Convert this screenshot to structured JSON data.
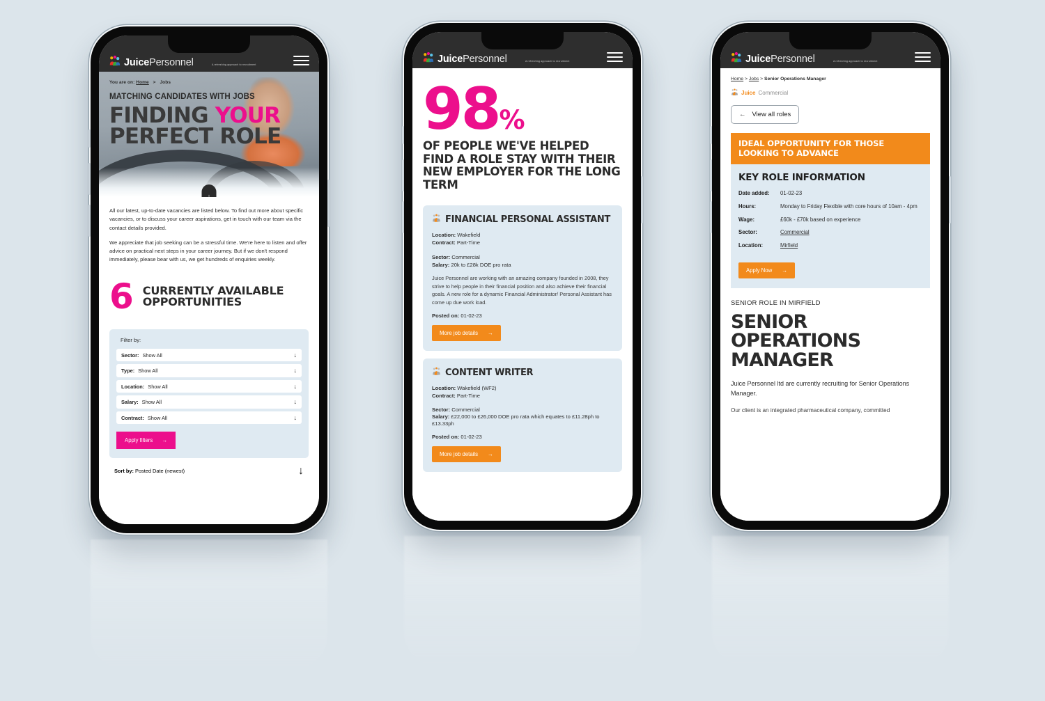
{
  "brand": {
    "name_bold": "Juice",
    "name_light": "Personnel",
    "tagline": "A refreshing approach to recruitment",
    "logo_icon": "people-logo-icon",
    "menu_icon": "hamburger-menu-icon"
  },
  "colors": {
    "background": "#dce5eb",
    "header": "#2e2e2e",
    "pink": "#ec0f8c",
    "orange": "#f28a1b",
    "card": "#dfeaf2",
    "text": "#2b2b2b"
  },
  "phone1": {
    "breadcrumb": {
      "prefix": "You are on:",
      "home": "Home",
      "separator": ">",
      "current": "Jobs"
    },
    "hero": {
      "kicker": "MATCHING CANDIDATES WITH JOBS",
      "title_line1_a": "FINDING ",
      "title_line1_b": "YOUR",
      "title_line2": "PERFECT ROLE",
      "scroll_icon": "scroll-down-arrow-icon"
    },
    "intro": {
      "p1": "All our latest, up-to-date vacancies are listed below. To find out more about specific vacancies, or to discuss your career aspirations, get in touch with our team via the contact details provided.",
      "p2": "We appreciate that job seeking can be a stressful time. We're here to listen and offer advice on practical next steps in your career journey. But if we don't respond immediately, please bear with us, we get hundreds of enquiries weekly."
    },
    "stat": {
      "number": "6",
      "label": "CURRENTLY AVAILABLE OPPORTUNITIES"
    },
    "filters": {
      "title": "Filter by:",
      "rows": [
        {
          "label": "Sector:",
          "value": "Show All",
          "icon": "chevron-down-icon"
        },
        {
          "label": "Type:",
          "value": "Show All",
          "icon": "chevron-down-icon"
        },
        {
          "label": "Location:",
          "value": "Show All",
          "icon": "chevron-down-icon"
        },
        {
          "label": "Salary:",
          "value": "Show All",
          "icon": "chevron-down-icon"
        },
        {
          "label": "Contract:",
          "value": "Show All",
          "icon": "chevron-down-icon"
        }
      ],
      "apply_label": "Apply filters",
      "apply_icon": "arrow-right-icon"
    },
    "sort": {
      "label": "Sort by:",
      "value": "Posted Date (newest)",
      "icon": "chevron-down-icon"
    }
  },
  "phone2": {
    "stat": {
      "number": "98",
      "percent": "%",
      "copy": "OF PEOPLE WE'VE HELPED FIND A ROLE STAY WITH THEIR NEW EMPLOYER FOR THE LONG TERM"
    },
    "jobs": [
      {
        "icon": "juice-people-icon",
        "title": "FINANCIAL PERSONAL ASSISTANT",
        "location_label": "Location:",
        "location": "Wakefield",
        "contract_label": "Contract:",
        "contract": "Part-Time",
        "sector_label": "Sector:",
        "sector": "Commercial",
        "salary_label": "Salary:",
        "salary": "20k to £28k DOE pro rata",
        "description": "Juice Personnel are working with an amazing company founded in 2008, they strive to help people in their financial position and also achieve their financial goals. A new role for a dynamic Financial Administrator/ Personal Assistant has come up due work load.",
        "posted_label": "Posted on:",
        "posted": "01-02-23",
        "cta": "More job details",
        "cta_icon": "arrow-right-icon"
      },
      {
        "icon": "juice-people-icon",
        "title": "CONTENT WRITER",
        "location_label": "Location:",
        "location": "Wakefield (WF2)",
        "contract_label": "Contract:",
        "contract": "Part-Time",
        "sector_label": "Sector:",
        "sector": "Commercial",
        "salary_label": "Salary:",
        "salary": "£22,000 to £26,000 DOE pro rata which equates to £11.28ph to £13.33ph",
        "description": "",
        "posted_label": "Posted on:",
        "posted": "01-02-23",
        "cta": "More job details",
        "cta_icon": "arrow-right-icon"
      }
    ]
  },
  "phone3": {
    "breadcrumb": {
      "home": "Home",
      "jobs": "Jobs",
      "separator": ">",
      "current": "Senior Operations Manager"
    },
    "division": {
      "icon": "juice-people-icon",
      "bold": "Juice",
      "light": "Commercial"
    },
    "back_button": {
      "label": "View all roles",
      "icon": "arrow-left-icon"
    },
    "banner": "IDEAL OPPORTUNITY FOR THOSE LOOKING TO ADVANCE",
    "info": {
      "title": "KEY ROLE INFORMATION",
      "rows": [
        {
          "key": "Date added:",
          "value": "01-02-23",
          "link": false
        },
        {
          "key": "Hours:",
          "value": "Monday to Friday Flexible with core hours of 10am - 4pm",
          "link": false
        },
        {
          "key": "Wage:",
          "value": "£60k - £70k based on experience",
          "link": false
        },
        {
          "key": "Sector:",
          "value": "Commercial",
          "link": true
        },
        {
          "key": "Location:",
          "value": "Mirfield",
          "link": true
        }
      ],
      "apply_label": "Apply Now",
      "apply_icon": "arrow-right-icon"
    },
    "role": {
      "kicker": "SENIOR ROLE IN MIRFIELD",
      "title": "SENIOR OPERATIONS MANAGER",
      "p1": "Juice Personnel ltd are currently recruiting for Senior Operations Manager.",
      "p2": "Our client is an integrated pharmaceutical company, committed"
    }
  }
}
